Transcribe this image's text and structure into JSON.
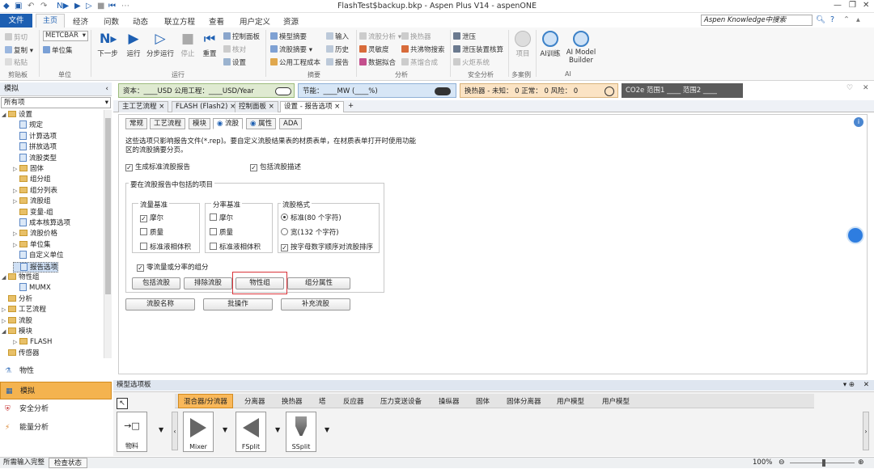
{
  "window": {
    "title": "FlashTest$backup.bkp - Aspen Plus V14 - aspenONE"
  },
  "ribbon_tabs": [
    "文件",
    "主页",
    "经济",
    "问数",
    "动态",
    "联立方程",
    "查看",
    "用户定义",
    "资源"
  ],
  "search": {
    "placeholder": "Aspen Knowledge中搜索"
  },
  "ribbon": {
    "clipboard": {
      "cut": "剪切",
      "copy": "复制 ▾",
      "paste": "粘贴",
      "group": "剪贴板"
    },
    "units": {
      "unit_set": "METCBAR",
      "unit_set_btn": "单位集",
      "group": "单位"
    },
    "run": {
      "next": "下一步",
      "run": "运行",
      "step": "分步运行",
      "stop": "停止",
      "reset": "重置",
      "control_panel": "控制面板",
      "check": "核对",
      "settings": "设置",
      "group": "运行"
    },
    "summary": {
      "model_summary": "模型摘要",
      "stream_summary": "流股摘要 ▾",
      "utility_cost": "公用工程成本",
      "input": "输入",
      "history": "历史",
      "report": "报告",
      "group": "摘要"
    },
    "analysis": {
      "stream_analysis": "流股分析 ▾",
      "heat_exchanger": "换热器",
      "sensitivity": "灵敏度",
      "azeotrope": "共沸物搜索",
      "data_fit": "数据拟合",
      "distill_synth": "蒸馏合成",
      "group": "分析"
    },
    "safety": {
      "pressure_relief": "泄压",
      "relief_check": "泄压装置核算",
      "flare": "火炬系统",
      "group": "安全分析"
    },
    "multi_case": {
      "project": "项目",
      "group": "多案例"
    },
    "ai": {
      "ai_train": "AI训练",
      "ai_builder": "AI Model Builder",
      "group": "AI"
    }
  },
  "status_strip": {
    "capital": "资本：____USD  公用工程：____USD/Year",
    "energy": "节能：____MW  (____%)",
    "hx": "换热器 - 未知： 0  正常： 0  风险： 0",
    "co2": "CO2e 范围1 ____  范围2 ____"
  },
  "left_panel": {
    "header": "模拟",
    "filter": "所有项",
    "tree": [
      {
        "label": "设置",
        "level": 0,
        "toggle": "◢",
        "kind": "folder"
      },
      {
        "label": "规定",
        "level": 1,
        "toggle": "",
        "kind": "page"
      },
      {
        "label": "计算选项",
        "level": 1,
        "toggle": "",
        "kind": "page"
      },
      {
        "label": "拼放选项",
        "level": 1,
        "toggle": "",
        "kind": "page"
      },
      {
        "label": "流股类型",
        "level": 1,
        "toggle": "",
        "kind": "page"
      },
      {
        "label": "固体",
        "level": 1,
        "toggle": "▷",
        "kind": "folder"
      },
      {
        "label": "组分组",
        "level": 1,
        "toggle": "",
        "kind": "folder"
      },
      {
        "label": "组分列表",
        "level": 1,
        "toggle": "▷",
        "kind": "folder"
      },
      {
        "label": "流股组",
        "level": 1,
        "toggle": "▷",
        "kind": "folder"
      },
      {
        "label": "变量-组",
        "level": 1,
        "toggle": "",
        "kind": "folder"
      },
      {
        "label": "成本核算选项",
        "level": 1,
        "toggle": "",
        "kind": "page"
      },
      {
        "label": "流股价格",
        "level": 1,
        "toggle": "▷",
        "kind": "folder"
      },
      {
        "label": "单位集",
        "level": 1,
        "toggle": "▷",
        "kind": "folder"
      },
      {
        "label": "自定义单位",
        "level": 1,
        "toggle": "",
        "kind": "page"
      },
      {
        "label": "报告选项",
        "level": 1,
        "toggle": "",
        "kind": "page"
      },
      {
        "label": "物性组",
        "level": 0,
        "toggle": "◢",
        "kind": "folder"
      },
      {
        "label": "MUMX",
        "level": 1,
        "toggle": "",
        "kind": "page"
      },
      {
        "label": "分析",
        "level": 0,
        "toggle": "",
        "kind": "folder"
      },
      {
        "label": "工艺流程",
        "level": 0,
        "toggle": "▷",
        "kind": "folder"
      },
      {
        "label": "流股",
        "level": 0,
        "toggle": "▷",
        "kind": "folder"
      },
      {
        "label": "模块",
        "level": 0,
        "toggle": "◢",
        "kind": "folder"
      },
      {
        "label": "FLASH",
        "level": 1,
        "toggle": "▷",
        "kind": "folder"
      },
      {
        "label": "传感器",
        "level": 0,
        "toggle": "",
        "kind": "folder"
      }
    ],
    "nav": [
      "物性",
      "模拟",
      "安全分析",
      "能量分析"
    ]
  },
  "doc_tabs": [
    "主工艺流程 ×",
    "FLASH (Flash2) ×",
    "控制面板 ×",
    "设置 - 报告选项 ×",
    "+"
  ],
  "sub_tabs": [
    "常规",
    "工艺流程",
    "模块",
    "流股",
    "属性",
    "ADA"
  ],
  "form": {
    "desc": "这些选项只影响报告文件(*.rep)。要自定义流股结果表的材质表单，在材质表单打开时使用功能区的流股摘要分页。",
    "gen_report": "生成标准流股报告",
    "incl_desc": "包括流股描述",
    "group_title": "要在流股报告中包括的项目",
    "flow_basis": {
      "title": "流量基准",
      "items": [
        "摩尔",
        "质量",
        "标准液相体积"
      ],
      "checked": [
        true,
        false,
        false
      ]
    },
    "frac_basis": {
      "title": "分率基准",
      "items": [
        "摩尔",
        "质量",
        "标准液相体积"
      ],
      "checked": [
        false,
        false,
        false
      ]
    },
    "stream_format": {
      "title": "流股格式",
      "items": [
        "标准(80 个字符)",
        "宽(132 个字符)"
      ],
      "sort": "按字母数字顺序对流股排序"
    },
    "zero_flow": "零流量或分率的组分",
    "buttons_row1": [
      "包括流股",
      "排除流股",
      "物性组",
      "组分属性"
    ],
    "buttons_row2": [
      "流股名称",
      "批操作",
      "补充流股"
    ]
  },
  "palette": {
    "title": "模型选项板",
    "tabs": [
      "混合器/分流器",
      "分离器",
      "换热器",
      "塔",
      "反应器",
      "压力变送设备",
      "操纵器",
      "固体",
      "固体分离器",
      "用户模型",
      "用户模型"
    ],
    "items": [
      "物料",
      "Mixer",
      "FSplit",
      "SSplit"
    ]
  },
  "statusbar": {
    "left": "所需输入完整",
    "check": "检查状态",
    "zoom": "100%"
  },
  "colors": {
    "brand": "#1d5fb2",
    "highlight": "#d9343a",
    "status_green": "#dfead1",
    "status_blue": "#d7e6f6",
    "status_orange": "#fbe3c4",
    "status_gray": "#5b5b5b"
  }
}
